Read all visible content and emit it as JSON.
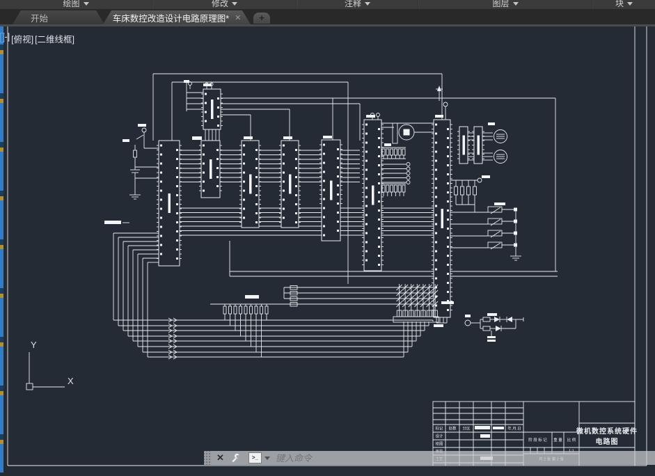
{
  "ribbon": {
    "panels": [
      {
        "label": "绘图"
      },
      {
        "label": "修改"
      },
      {
        "label": "注释"
      },
      {
        "label": "图层"
      },
      {
        "label": "块"
      }
    ]
  },
  "file_tabs": {
    "start_tab": "开始",
    "active_tab": "车床数控改造设计电路原理图*",
    "close_glyph": "✕",
    "new_tab_glyph": "+"
  },
  "viewport_controls": {
    "menu": "[-]",
    "view": "[俯视]",
    "visual_style": "[二维线框]"
  },
  "ucs": {
    "x_label": "X",
    "y_label": "Y"
  },
  "command_bar": {
    "placeholder": "键入命令",
    "close_glyph": "✕",
    "prompt_glyph": ">_"
  },
  "title_block": {
    "header_cells": [
      "标记",
      "处数",
      "分区",
      "年.月.日"
    ],
    "rows": [
      "设计",
      "绘图",
      "审核",
      "工艺"
    ],
    "stage_label": "阶 段 标 记",
    "weight_label": "重 量",
    "scale_label": "比 例",
    "scale_value": "1:1",
    "sheet_info": "共 2 张 第 2 张",
    "title_line1": "微机数控系统硬件",
    "title_line2": "电路图"
  },
  "colors": {
    "canvas_bg": "#242b35",
    "schematic_line": "#e9ecef",
    "ribbon_bg": "#3b3b3c",
    "tabbar_bg": "#292929",
    "dock_accent_blue": "#2e7ecf",
    "command_bar_bg": "rgba(198,201,205,0.74)"
  }
}
